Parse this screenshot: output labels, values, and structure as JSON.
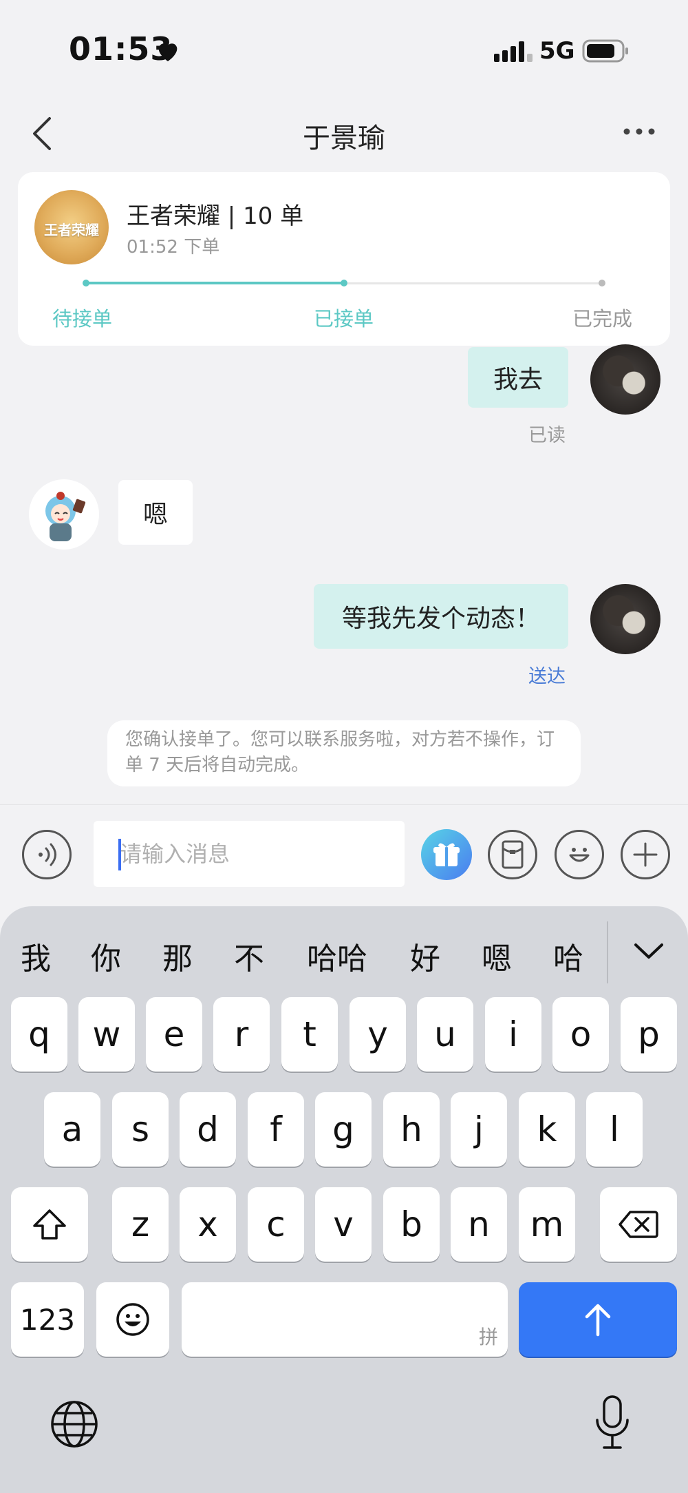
{
  "status_bar": {
    "time": "01:53",
    "network": "5G"
  },
  "nav": {
    "title": "于景瑜"
  },
  "order_card": {
    "game_logo_text": "王者荣耀",
    "title": "王者荣耀 | 10 单",
    "time": "01:52 下单",
    "steps": [
      "待接单",
      "已接单",
      "已完成"
    ],
    "progress": 0.5
  },
  "messages": [
    {
      "from": "me",
      "text": "我去",
      "status": "已读"
    },
    {
      "from": "other",
      "text": "嗯"
    },
    {
      "from": "me",
      "text": "等我先发个动态！",
      "status": "送达"
    }
  ],
  "system_note": "您确认接单了。您可以联系服务啦，对方若不操作，订单 7 天后将自动完成。",
  "input": {
    "placeholder": "请输入消息"
  },
  "keyboard": {
    "candidates": [
      "我",
      "你",
      "那",
      "不",
      "哈哈",
      "好",
      "嗯",
      "哈"
    ],
    "row1": [
      "q",
      "w",
      "e",
      "r",
      "t",
      "y",
      "u",
      "i",
      "o",
      "p"
    ],
    "row2": [
      "a",
      "s",
      "d",
      "f",
      "g",
      "h",
      "j",
      "k",
      "l"
    ],
    "row3": [
      "z",
      "x",
      "c",
      "v",
      "b",
      "n",
      "m"
    ],
    "numbers_key": "123",
    "space_hint": "拼"
  },
  "colors": {
    "accent": "#5cc8c4",
    "bubble_me": "#d4f1ee",
    "delivered": "#4a7cd6",
    "send": "#3478f6"
  }
}
